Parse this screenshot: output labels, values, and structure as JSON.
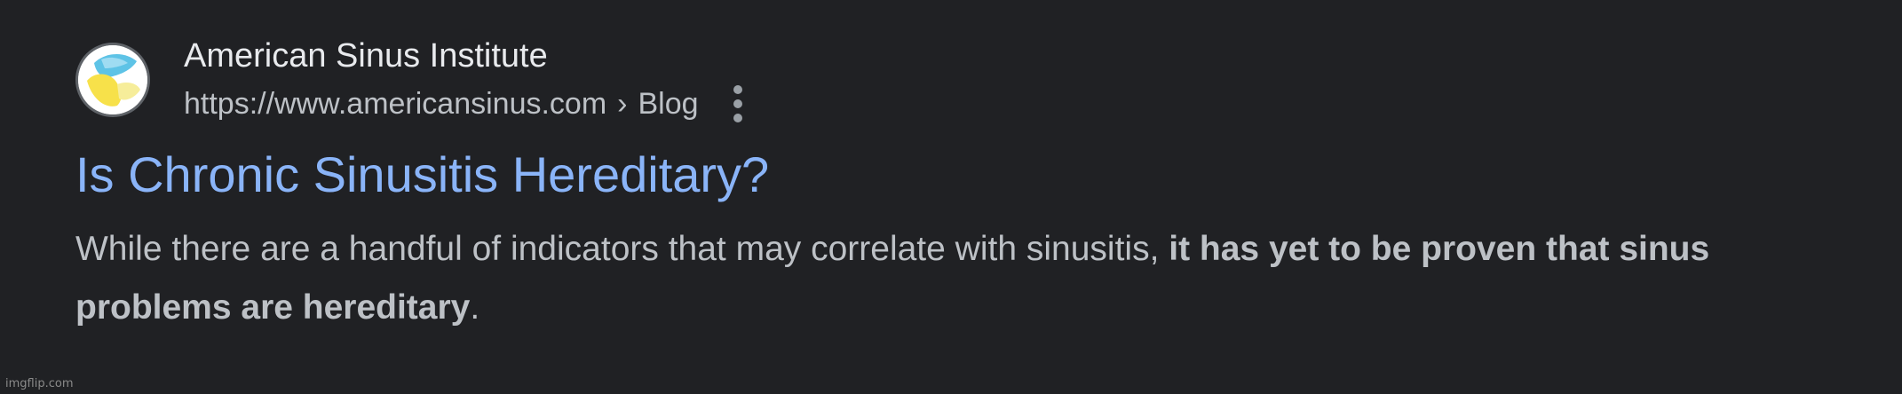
{
  "result": {
    "site_name": "American Sinus Institute",
    "url": {
      "domain": "https://www.americansinus.com",
      "separator": "›",
      "path": "Blog"
    },
    "favicon": {
      "icon_name": "american-sinus-institute-logo",
      "colors": [
        "#5ec3e6",
        "#f7e14a",
        "#ffffff"
      ]
    },
    "more_icon": "more-vertical-icon",
    "title": "Is Chronic Sinusitis Hereditary?",
    "snippet": {
      "plain_before": "While there are a handful of indicators that may correlate with sinusitis, ",
      "bold": "it has yet to be proven that sinus problems are hereditary",
      "plain_after": "."
    }
  },
  "colors": {
    "background": "#202124",
    "title_link": "#8ab4f8",
    "site_name": "#e8eaed",
    "secondary_text": "#bdc1c6"
  },
  "watermark": "imgflip.com"
}
